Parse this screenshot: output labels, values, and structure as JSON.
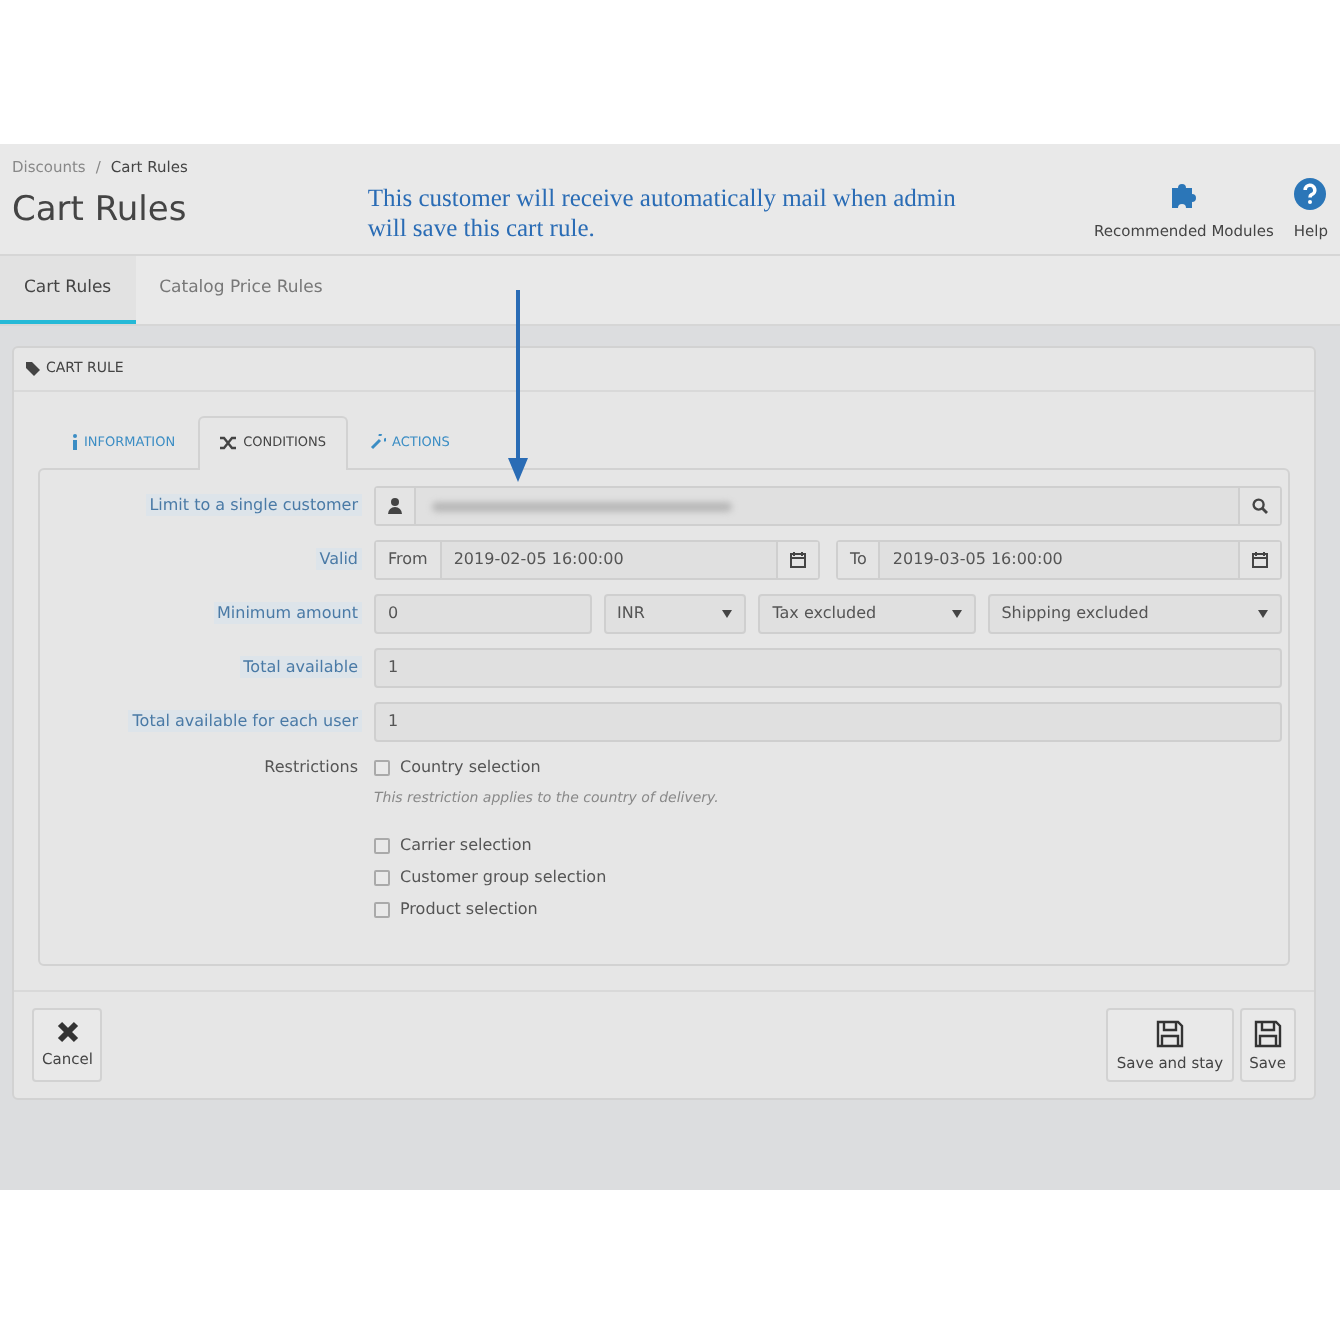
{
  "breadcrumb": {
    "items": [
      "Discounts",
      "Cart Rules"
    ],
    "separator": "/"
  },
  "page_title": "Cart Rules",
  "annotation": {
    "text": "This customer will receive automatically mail when admin will save this cart rule."
  },
  "toolbar": [
    {
      "label": "Recommended Modules"
    },
    {
      "label": "Help"
    }
  ],
  "page_tabs": [
    {
      "label": "Cart Rules",
      "selected": true
    },
    {
      "label": "Catalog Price Rules",
      "selected": false
    }
  ],
  "panel": {
    "title": "CART RULE",
    "tabs": [
      {
        "label": "INFORMATION",
        "selected": false
      },
      {
        "label": "CONDITIONS",
        "selected": true
      },
      {
        "label": "ACTIONS",
        "selected": false
      }
    ],
    "rows": [
      {
        "kind": "customer",
        "label": "Limit to a single customer"
      },
      {
        "kind": "dates",
        "label": "Valid",
        "from_label": "From",
        "from_value": "2019-02-05 16:00:00",
        "to_label": "To",
        "to_value": "2019-03-05 16:00:00"
      },
      {
        "kind": "amount",
        "label": "Minimum amount",
        "value": "0",
        "selects": [
          "INR",
          "Tax excluded",
          "Shipping excluded"
        ]
      },
      {
        "kind": "text",
        "label": "Total available",
        "value": "1"
      },
      {
        "kind": "text",
        "label": "Total available for each user",
        "value": "1"
      },
      {
        "kind": "checks",
        "label": "Restrictions",
        "options": [
          {
            "label": "Country selection",
            "checked": false,
            "help": "This restriction applies to the country of delivery."
          },
          {
            "label": "Carrier selection",
            "checked": false
          },
          {
            "label": "Customer group selection",
            "checked": false
          },
          {
            "label": "Product selection",
            "checked": false
          }
        ]
      }
    ]
  },
  "footer": {
    "left": [
      {
        "label": "Cancel"
      }
    ],
    "right": [
      {
        "label": "Save and stay"
      },
      {
        "label": "Save"
      }
    ]
  }
}
